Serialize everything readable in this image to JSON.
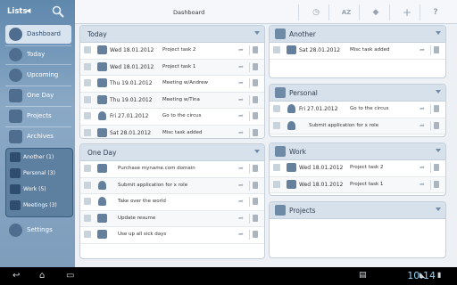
{
  "sidebar": {
    "title": "Lists",
    "nav": [
      {
        "label": "Dashboard"
      },
      {
        "label": "Today"
      },
      {
        "label": "Upcoming"
      },
      {
        "label": "One Day"
      },
      {
        "label": "Projects"
      },
      {
        "label": "Archives"
      }
    ],
    "lists": [
      {
        "label": "Another (1)"
      },
      {
        "label": "Personal (3)"
      },
      {
        "label": "Work (5)"
      },
      {
        "label": "Meetings (3)"
      }
    ],
    "settings_label": "Settings"
  },
  "header": {
    "title": "Dashboard",
    "sort_label": "AZ"
  },
  "panels": {
    "today": {
      "title": "Today",
      "tasks": [
        {
          "date": "Wed 18.01.2012",
          "title": "Project task 2"
        },
        {
          "date": "Wed 18.01.2012",
          "title": "Project task 1"
        },
        {
          "date": "Thu 19.01.2012",
          "title": "Meeting w/Andrew"
        },
        {
          "date": "Thu 19.01.2012",
          "title": "Meeting w/Tina"
        },
        {
          "date": "Fri 27.01.2012",
          "title": "Go to the circus"
        },
        {
          "date": "Sat 28.01.2012",
          "title": "Misc task added"
        }
      ]
    },
    "one_day": {
      "title": "One Day",
      "tasks": [
        {
          "title": "Purchase myname.com domain"
        },
        {
          "title": "Submit application for x role"
        },
        {
          "title": "Take over the world"
        },
        {
          "title": "Update resume"
        },
        {
          "title": "Use up all sick days"
        }
      ]
    },
    "another": {
      "title": "Another",
      "tasks": [
        {
          "date": "Sat 28.01.2012",
          "title": "Misc task added"
        }
      ]
    },
    "personal": {
      "title": "Personal",
      "tasks": [
        {
          "date": "Fri 27.01.2012",
          "title": "Go to the circus"
        },
        {
          "date": "",
          "title": "Submit application for x role"
        }
      ]
    },
    "work": {
      "title": "Work",
      "tasks": [
        {
          "date": "Wed 18.01.2012",
          "title": "Project task 2"
        },
        {
          "date": "Wed 18.01.2012",
          "title": "Project task 1"
        }
      ]
    },
    "projects": {
      "title": "Projects"
    }
  },
  "systembar": {
    "time": "10:14"
  }
}
